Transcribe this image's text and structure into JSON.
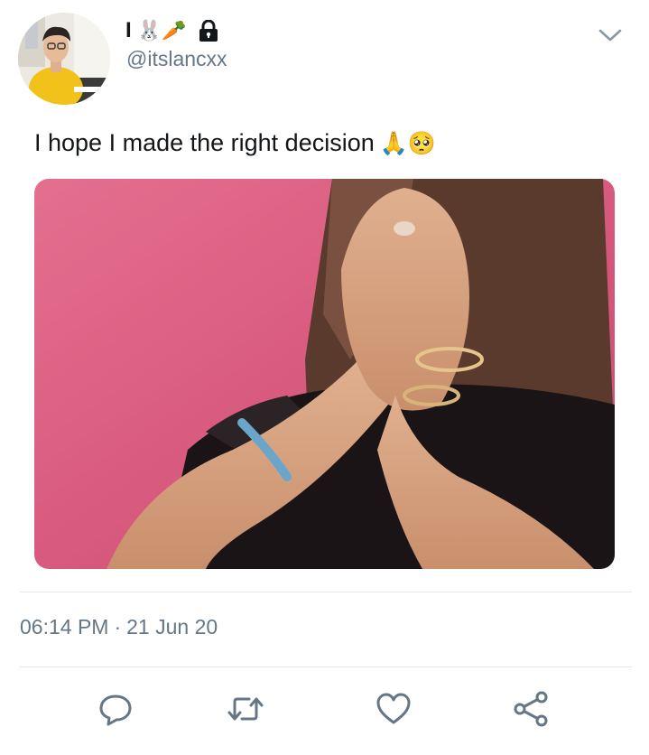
{
  "user": {
    "display_name": "I",
    "name_emojis": "🐰🥕",
    "handle": "@itslancxx",
    "protected_icon": "lock-icon",
    "avatar_icon": "profile-avatar"
  },
  "tweet": {
    "text": "I hope I made the right decision",
    "text_emojis": "🙏🥺",
    "media_icon": "gif-image",
    "time": "06:14 PM",
    "separator": "·",
    "date": "21 Jun 20"
  },
  "actions": [
    {
      "name": "reply",
      "icon": "reply-icon"
    },
    {
      "name": "retweet",
      "icon": "retweet-icon"
    },
    {
      "name": "like",
      "icon": "heart-icon"
    },
    {
      "name": "share",
      "icon": "share-icon"
    }
  ],
  "colors": {
    "text_primary": "#14171a",
    "text_secondary": "#657786",
    "divider": "#e1e8ed",
    "icon": "#657786",
    "background": "#ffffff"
  }
}
